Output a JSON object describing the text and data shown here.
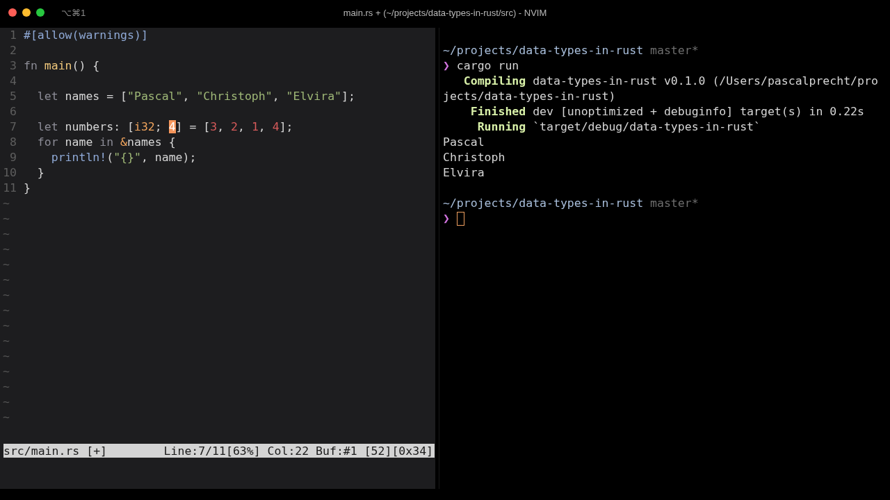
{
  "window": {
    "title": "main.rs + (~/projects/data-types-in-rust/src) - NVIM",
    "tab_shortcut": "⌥⌘1"
  },
  "editor": {
    "lines": [
      {
        "number": "1",
        "tokens": [
          {
            "text": "#[allow(warnings)]",
            "kind": "attr"
          }
        ]
      },
      {
        "number": "2"
      },
      {
        "number": "3",
        "tokens": [
          {
            "text": "fn ",
            "kind": "keyword"
          },
          {
            "text": "main",
            "kind": "func"
          },
          {
            "text": "() {",
            "kind": "plain"
          }
        ]
      },
      {
        "number": "4"
      },
      {
        "number": "5",
        "tokens": [
          {
            "text": "  let ",
            "kind": "keyword"
          },
          {
            "text": "names = [",
            "kind": "plain"
          },
          {
            "text": "\"Pascal\"",
            "kind": "string"
          },
          {
            "text": ", ",
            "kind": "plain"
          },
          {
            "text": "\"Christoph\"",
            "kind": "string"
          },
          {
            "text": ", ",
            "kind": "plain"
          },
          {
            "text": "\"Elvira\"",
            "kind": "string"
          },
          {
            "text": "];",
            "kind": "plain"
          }
        ]
      },
      {
        "number": "6"
      },
      {
        "number": "7",
        "tokens": [
          {
            "text": "  let ",
            "kind": "keyword"
          },
          {
            "text": "numbers: [",
            "kind": "plain"
          },
          {
            "text": "i32",
            "kind": "type"
          },
          {
            "text": "; ",
            "kind": "plain"
          },
          {
            "text": "4",
            "kind": "cursor"
          },
          {
            "text": "] = [",
            "kind": "plain"
          },
          {
            "text": "3",
            "kind": "number"
          },
          {
            "text": ", ",
            "kind": "plain"
          },
          {
            "text": "2",
            "kind": "number"
          },
          {
            "text": ", ",
            "kind": "plain"
          },
          {
            "text": "1",
            "kind": "number"
          },
          {
            "text": ", ",
            "kind": "plain"
          },
          {
            "text": "4",
            "kind": "number"
          },
          {
            "text": "];",
            "kind": "plain"
          }
        ]
      },
      {
        "number": "8",
        "tokens": [
          {
            "text": "  for ",
            "kind": "keyword"
          },
          {
            "text": "name ",
            "kind": "plain"
          },
          {
            "text": "in ",
            "kind": "keyword"
          },
          {
            "text": "&",
            "kind": "type"
          },
          {
            "text": "names {",
            "kind": "plain"
          }
        ]
      },
      {
        "number": "9",
        "tokens": [
          {
            "text": "    println!",
            "kind": "attr"
          },
          {
            "text": "(",
            "kind": "plain"
          },
          {
            "text": "\"{}\"",
            "kind": "string"
          },
          {
            "text": ", name);",
            "kind": "plain"
          }
        ]
      },
      {
        "number": "10",
        "tokens": [
          {
            "text": "  }",
            "kind": "plain"
          }
        ]
      },
      {
        "number": "11",
        "tokens": [
          {
            "text": "}",
            "kind": "plain"
          }
        ]
      }
    ],
    "tildes": [
      "~",
      "~",
      "~",
      "~",
      "~",
      "~",
      "~",
      "~",
      "~",
      "~",
      "~",
      "~",
      "~",
      "~",
      "~"
    ],
    "status_left": "src/main.rs [+]",
    "status_right": "Line:7/11[63%] Col:22 Buf:#1 [52][0x34]"
  },
  "terminal": {
    "lines": [
      {
        "segments": [
          {
            "text": "~/projects/data-types-in-rust",
            "kind": "path"
          },
          {
            "text": " master*",
            "kind": "branch"
          }
        ],
        "cursor": false
      },
      {
        "segments": [
          {
            "text": "❯",
            "kind": "prompt"
          },
          {
            "text": " cargo run",
            "kind": "plain"
          }
        ],
        "cursor": false
      },
      {
        "segments": [
          {
            "text": "   Compiling",
            "kind": "status"
          },
          {
            "text": " data-types-in-rust v0.1.0 (/Users/pascalprecht/pro",
            "kind": "plain"
          }
        ],
        "cursor": false
      },
      {
        "segments": [
          {
            "text": "jects/data-types-in-rust)",
            "kind": "plain"
          }
        ],
        "cursor": false
      },
      {
        "segments": [
          {
            "text": "    Finished",
            "kind": "status"
          },
          {
            "text": " dev [unoptimized + debuginfo] target(s) in 0.22s",
            "kind": "plain"
          }
        ],
        "cursor": false
      },
      {
        "segments": [
          {
            "text": "     Running",
            "kind": "status"
          },
          {
            "text": " `target/debug/data-types-in-rust`",
            "kind": "plain"
          }
        ],
        "cursor": false
      },
      {
        "segments": [
          {
            "text": "Pascal",
            "kind": "plain"
          }
        ],
        "cursor": false
      },
      {
        "segments": [
          {
            "text": "Christoph",
            "kind": "plain"
          }
        ],
        "cursor": false
      },
      {
        "segments": [
          {
            "text": "Elvira",
            "kind": "plain"
          }
        ],
        "cursor": false
      },
      {
        "cursor": false
      },
      {
        "segments": [
          {
            "text": "~/projects/data-types-in-rust",
            "kind": "path"
          },
          {
            "text": " master*",
            "kind": "branch"
          }
        ],
        "cursor": false
      },
      {
        "segments": [
          {
            "text": "❯",
            "kind": "prompt"
          }
        ],
        "cursor": true
      }
    ]
  }
}
